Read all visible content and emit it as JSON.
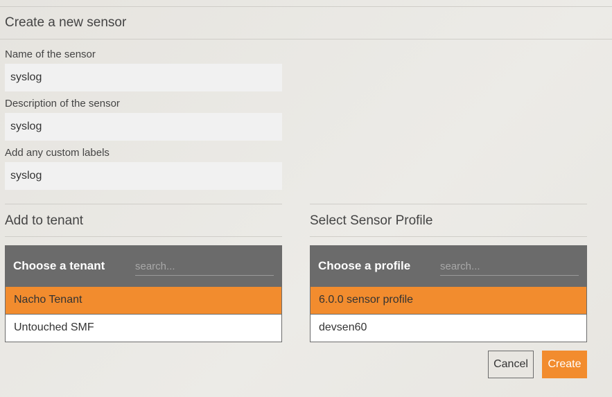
{
  "header": {
    "title": "Create a new sensor"
  },
  "form": {
    "name_label": "Name of the sensor",
    "name_value": "syslog",
    "description_label": "Description of the sensor",
    "description_value": "syslog",
    "labels_label": "Add any custom labels",
    "labels_value": "syslog"
  },
  "tenant": {
    "section_title": "Add to tenant",
    "picker_label": "Choose a tenant",
    "search_placeholder": "search...",
    "options": [
      {
        "label": "Nacho Tenant",
        "selected": true
      },
      {
        "label": "Untouched SMF",
        "selected": false
      }
    ]
  },
  "profile": {
    "section_title": "Select Sensor Profile",
    "picker_label": "Choose a profile",
    "search_placeholder": "search...",
    "options": [
      {
        "label": "6.0.0 sensor profile",
        "selected": true
      },
      {
        "label": "devsen60",
        "selected": false
      }
    ]
  },
  "actions": {
    "cancel_label": "Cancel",
    "create_label": "Create"
  },
  "colors": {
    "accent": "#f28c2e",
    "picker_header": "#6b6b6b",
    "field_bg": "#f1f1f1"
  }
}
